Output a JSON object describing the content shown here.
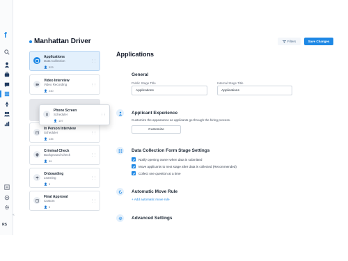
{
  "app": {
    "logo_letter": "f",
    "user_initials": "RS",
    "collapse_glyph": "«"
  },
  "rail": {
    "icons": [
      "search-icon",
      "user-icon",
      "briefcase-icon",
      "chat-icon",
      "workflow-icon",
      "rocket-icon",
      "team-icon",
      "chart-icon",
      "expand-icon",
      "settings-icon",
      "gear-icon"
    ]
  },
  "header": {
    "title": "Manhattan Driver",
    "caret": "⌄",
    "filters_label": "Filters",
    "save_label": "Save Changes"
  },
  "stages": [
    {
      "name": "Applications",
      "type": "Data Collection",
      "count": "323",
      "active": true
    },
    {
      "name": "Video Interview",
      "type": "Video Recording",
      "count": "240"
    },
    {
      "name": "In Person Interview",
      "type": "Scheduler",
      "count": "135"
    },
    {
      "name": "Criminal Check",
      "type": "Background Check",
      "count": "39"
    },
    {
      "name": "Onboarding",
      "type": "Learning",
      "count": "3"
    },
    {
      "name": "Final Approval",
      "type": "Custom",
      "count": "5"
    }
  ],
  "dragging_stage": {
    "name": "Phone Screen",
    "type": "Scheduler",
    "count": "107"
  },
  "main": {
    "title": "Applications",
    "general": {
      "title": "General",
      "public_label": "Public Stage Title",
      "public_value": "Applications",
      "internal_label": "Internal Stage Title",
      "internal_value": "Applications"
    },
    "experience": {
      "title": "Applicant Experience",
      "description": "Customize the appearance as applicants go through the hiring process.",
      "button": "Customize"
    },
    "form_settings": {
      "title": "Data Collection Form Stage Settings",
      "options": [
        "Notify opening owner when data is submitted",
        "Move applicants to next stage after data is collected (Recommended)",
        "Collect one question at a time"
      ]
    },
    "auto_move": {
      "title": "Automatic Move Rule",
      "add_link": "+ Add automatic move rule"
    },
    "advanced": {
      "title": "Advanced Settings"
    }
  },
  "colors": {
    "accent": "#1e88e5",
    "active_stage_bg": "#e3f0fc"
  }
}
